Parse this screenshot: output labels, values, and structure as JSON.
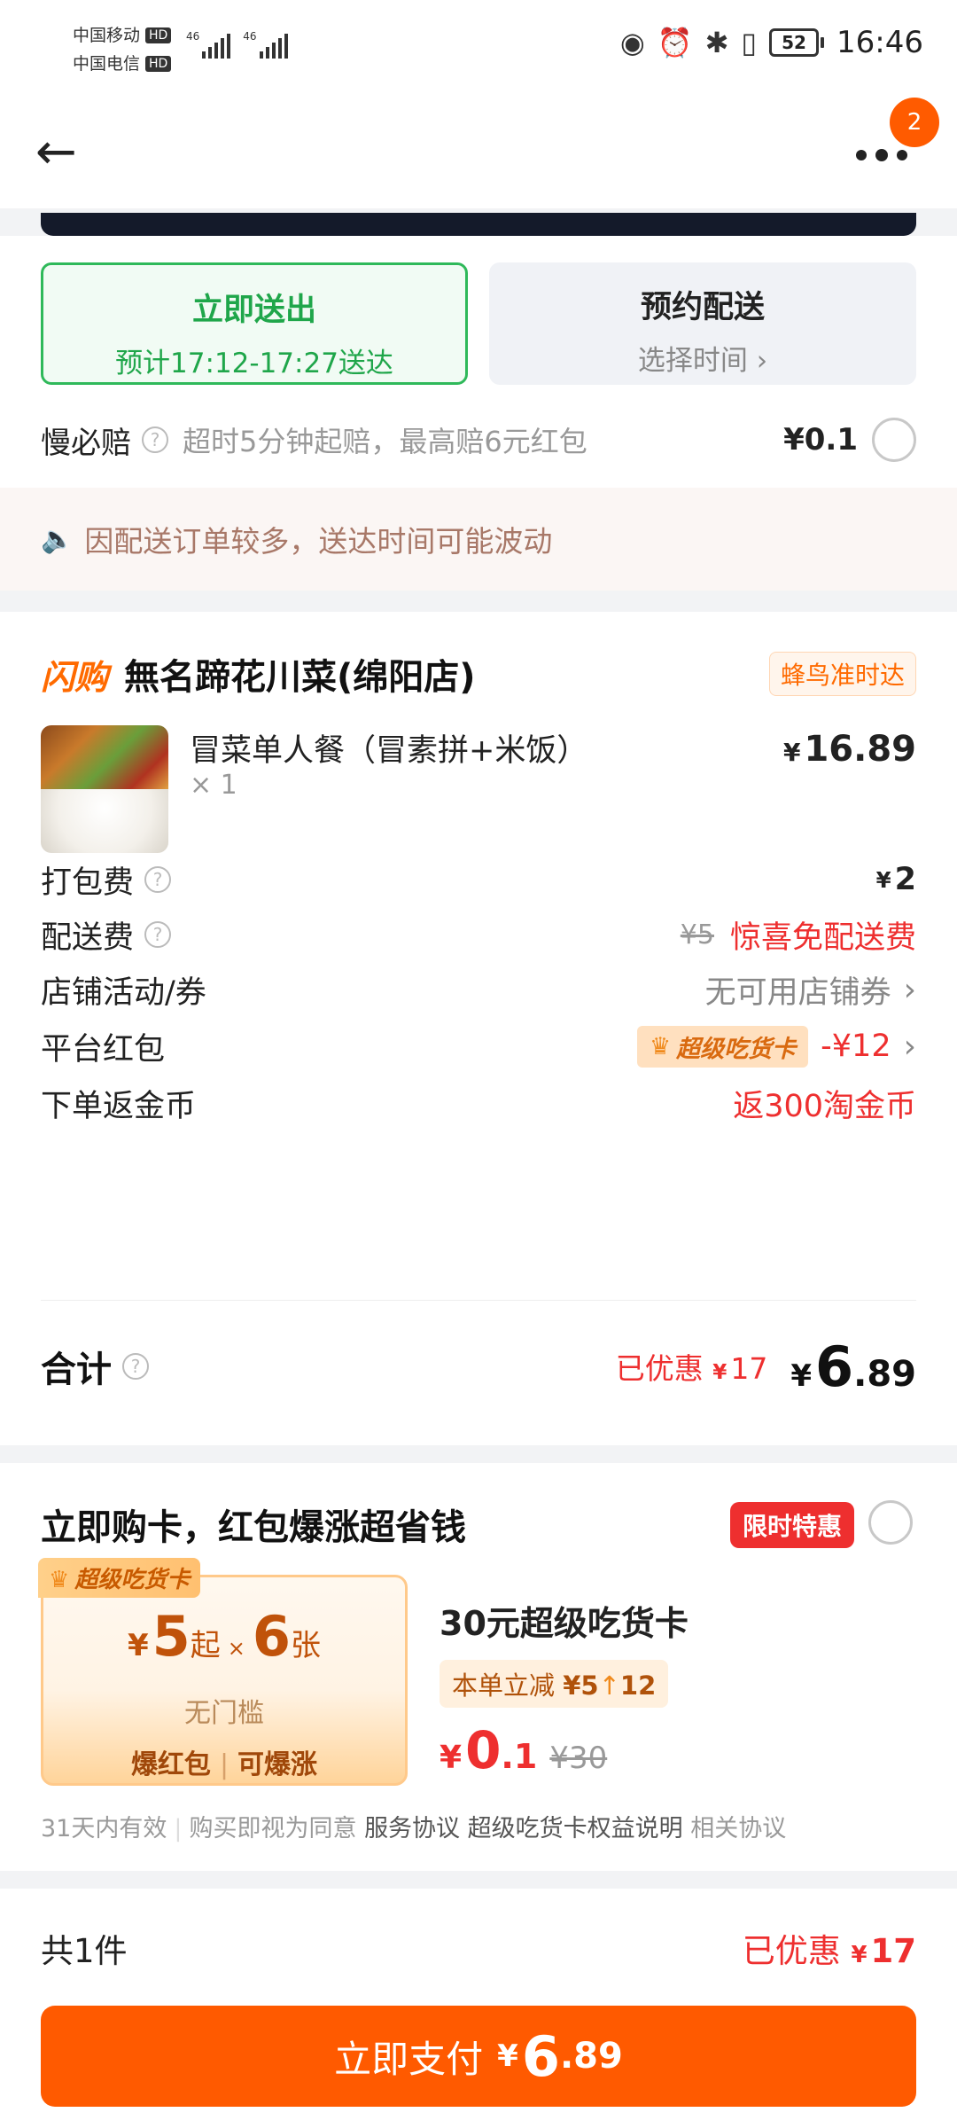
{
  "status_bar": {
    "carrier1": "中国移动",
    "carrier2": "中国电信",
    "hd": "HD",
    "network": "46",
    "battery": "52",
    "time": "16:46",
    "icons": [
      "eye-icon",
      "alarm-icon",
      "bluetooth-icon",
      "vibrate-icon"
    ]
  },
  "nav": {
    "back_icon": "←",
    "badge": "2"
  },
  "delivery": {
    "now_title": "立即送出",
    "now_sub": "预计17:12-17:27送达",
    "sched_title": "预约配送",
    "sched_sub": "选择时间",
    "guarantee_label": "慢必赔",
    "guarantee_desc": "超时5分钟起赔，最高赔6元红包",
    "guarantee_price": "¥0.1",
    "notice": "因配送订单较多，送达时间可能波动"
  },
  "order": {
    "brand": "闪购",
    "shop_name": "無名蹄花川菜(绵阳店)",
    "ontime_tag": "蜂鸟准时达",
    "item_name": "冒菜单人餐（冒素拼+米饭）",
    "item_qty": "× 1",
    "item_price": "16.89",
    "packing_label": "打包费",
    "packing_value": "2",
    "delivery_fee_label": "配送费",
    "delivery_fee_orig": "¥5",
    "delivery_fee_value": "惊喜免配送费",
    "store_promo_label": "店铺活动/券",
    "store_promo_value": "无可用店铺券",
    "redpacket_label": "平台红包",
    "redpacket_tag": "超级吃货卡",
    "redpacket_value": "-¥12",
    "coins_label": "下单返金币",
    "coins_value": "返300淘金币",
    "total_label": "合计",
    "total_discount_prefix": "已优惠",
    "total_discount": "17",
    "total_int": "6",
    "total_dec": ".89"
  },
  "promo": {
    "title": "立即购卡，红包爆涨超省钱",
    "limited_tag": "限时特惠",
    "card_tag": "超级吃货卡",
    "card_amount": "5",
    "card_from": "起",
    "card_count": "6",
    "card_unit": "张",
    "card_threshold": "无门槛",
    "card_bottom_1": "爆红包",
    "card_bottom_2": "可爆涨",
    "card_name": "30元超级吃货卡",
    "card_saving_prefix": "本单立减",
    "card_saving_from": "¥5",
    "card_saving_to": "12",
    "card_price_int": "0",
    "card_price_dec": ".1",
    "card_price_orig": "¥30",
    "terms_valid": "31天内有效",
    "terms_agree": "购买即视为同意",
    "terms_link1": "服务协议",
    "terms_link2": "超级吃货卡权益说明",
    "terms_link3": "相关协议"
  },
  "bottom": {
    "count": "共1件",
    "discount_prefix": "已优惠",
    "discount": "17",
    "pay_label": "立即支付",
    "pay_int": "6",
    "pay_dec": ".89"
  },
  "colors": {
    "accent": "#ff5a00",
    "green": "#1fa64a",
    "red": "#ee2f2f"
  }
}
